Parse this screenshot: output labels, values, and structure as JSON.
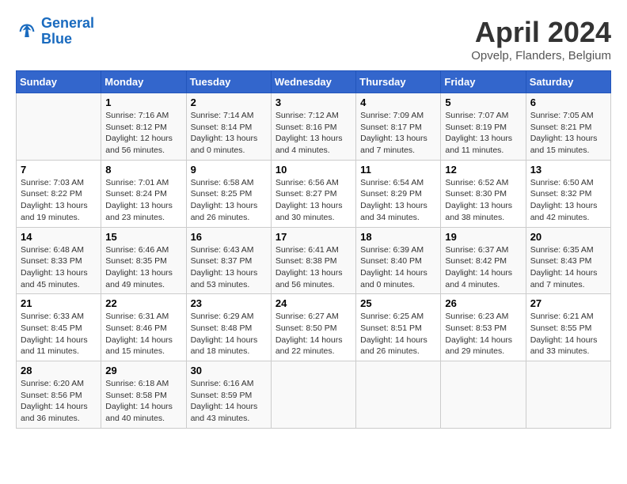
{
  "header": {
    "logo_line1": "General",
    "logo_line2": "Blue",
    "month_title": "April 2024",
    "location": "Opvelp, Flanders, Belgium"
  },
  "weekdays": [
    "Sunday",
    "Monday",
    "Tuesday",
    "Wednesday",
    "Thursday",
    "Friday",
    "Saturday"
  ],
  "weeks": [
    [
      {
        "day": "",
        "sunrise": "",
        "sunset": "",
        "daylight": ""
      },
      {
        "day": "1",
        "sunrise": "Sunrise: 7:16 AM",
        "sunset": "Sunset: 8:12 PM",
        "daylight": "Daylight: 12 hours and 56 minutes."
      },
      {
        "day": "2",
        "sunrise": "Sunrise: 7:14 AM",
        "sunset": "Sunset: 8:14 PM",
        "daylight": "Daylight: 13 hours and 0 minutes."
      },
      {
        "day": "3",
        "sunrise": "Sunrise: 7:12 AM",
        "sunset": "Sunset: 8:16 PM",
        "daylight": "Daylight: 13 hours and 4 minutes."
      },
      {
        "day": "4",
        "sunrise": "Sunrise: 7:09 AM",
        "sunset": "Sunset: 8:17 PM",
        "daylight": "Daylight: 13 hours and 7 minutes."
      },
      {
        "day": "5",
        "sunrise": "Sunrise: 7:07 AM",
        "sunset": "Sunset: 8:19 PM",
        "daylight": "Daylight: 13 hours and 11 minutes."
      },
      {
        "day": "6",
        "sunrise": "Sunrise: 7:05 AM",
        "sunset": "Sunset: 8:21 PM",
        "daylight": "Daylight: 13 hours and 15 minutes."
      }
    ],
    [
      {
        "day": "7",
        "sunrise": "Sunrise: 7:03 AM",
        "sunset": "Sunset: 8:22 PM",
        "daylight": "Daylight: 13 hours and 19 minutes."
      },
      {
        "day": "8",
        "sunrise": "Sunrise: 7:01 AM",
        "sunset": "Sunset: 8:24 PM",
        "daylight": "Daylight: 13 hours and 23 minutes."
      },
      {
        "day": "9",
        "sunrise": "Sunrise: 6:58 AM",
        "sunset": "Sunset: 8:25 PM",
        "daylight": "Daylight: 13 hours and 26 minutes."
      },
      {
        "day": "10",
        "sunrise": "Sunrise: 6:56 AM",
        "sunset": "Sunset: 8:27 PM",
        "daylight": "Daylight: 13 hours and 30 minutes."
      },
      {
        "day": "11",
        "sunrise": "Sunrise: 6:54 AM",
        "sunset": "Sunset: 8:29 PM",
        "daylight": "Daylight: 13 hours and 34 minutes."
      },
      {
        "day": "12",
        "sunrise": "Sunrise: 6:52 AM",
        "sunset": "Sunset: 8:30 PM",
        "daylight": "Daylight: 13 hours and 38 minutes."
      },
      {
        "day": "13",
        "sunrise": "Sunrise: 6:50 AM",
        "sunset": "Sunset: 8:32 PM",
        "daylight": "Daylight: 13 hours and 42 minutes."
      }
    ],
    [
      {
        "day": "14",
        "sunrise": "Sunrise: 6:48 AM",
        "sunset": "Sunset: 8:33 PM",
        "daylight": "Daylight: 13 hours and 45 minutes."
      },
      {
        "day": "15",
        "sunrise": "Sunrise: 6:46 AM",
        "sunset": "Sunset: 8:35 PM",
        "daylight": "Daylight: 13 hours and 49 minutes."
      },
      {
        "day": "16",
        "sunrise": "Sunrise: 6:43 AM",
        "sunset": "Sunset: 8:37 PM",
        "daylight": "Daylight: 13 hours and 53 minutes."
      },
      {
        "day": "17",
        "sunrise": "Sunrise: 6:41 AM",
        "sunset": "Sunset: 8:38 PM",
        "daylight": "Daylight: 13 hours and 56 minutes."
      },
      {
        "day": "18",
        "sunrise": "Sunrise: 6:39 AM",
        "sunset": "Sunset: 8:40 PM",
        "daylight": "Daylight: 14 hours and 0 minutes."
      },
      {
        "day": "19",
        "sunrise": "Sunrise: 6:37 AM",
        "sunset": "Sunset: 8:42 PM",
        "daylight": "Daylight: 14 hours and 4 minutes."
      },
      {
        "day": "20",
        "sunrise": "Sunrise: 6:35 AM",
        "sunset": "Sunset: 8:43 PM",
        "daylight": "Daylight: 14 hours and 7 minutes."
      }
    ],
    [
      {
        "day": "21",
        "sunrise": "Sunrise: 6:33 AM",
        "sunset": "Sunset: 8:45 PM",
        "daylight": "Daylight: 14 hours and 11 minutes."
      },
      {
        "day": "22",
        "sunrise": "Sunrise: 6:31 AM",
        "sunset": "Sunset: 8:46 PM",
        "daylight": "Daylight: 14 hours and 15 minutes."
      },
      {
        "day": "23",
        "sunrise": "Sunrise: 6:29 AM",
        "sunset": "Sunset: 8:48 PM",
        "daylight": "Daylight: 14 hours and 18 minutes."
      },
      {
        "day": "24",
        "sunrise": "Sunrise: 6:27 AM",
        "sunset": "Sunset: 8:50 PM",
        "daylight": "Daylight: 14 hours and 22 minutes."
      },
      {
        "day": "25",
        "sunrise": "Sunrise: 6:25 AM",
        "sunset": "Sunset: 8:51 PM",
        "daylight": "Daylight: 14 hours and 26 minutes."
      },
      {
        "day": "26",
        "sunrise": "Sunrise: 6:23 AM",
        "sunset": "Sunset: 8:53 PM",
        "daylight": "Daylight: 14 hours and 29 minutes."
      },
      {
        "day": "27",
        "sunrise": "Sunrise: 6:21 AM",
        "sunset": "Sunset: 8:55 PM",
        "daylight": "Daylight: 14 hours and 33 minutes."
      }
    ],
    [
      {
        "day": "28",
        "sunrise": "Sunrise: 6:20 AM",
        "sunset": "Sunset: 8:56 PM",
        "daylight": "Daylight: 14 hours and 36 minutes."
      },
      {
        "day": "29",
        "sunrise": "Sunrise: 6:18 AM",
        "sunset": "Sunset: 8:58 PM",
        "daylight": "Daylight: 14 hours and 40 minutes."
      },
      {
        "day": "30",
        "sunrise": "Sunrise: 6:16 AM",
        "sunset": "Sunset: 8:59 PM",
        "daylight": "Daylight: 14 hours and 43 minutes."
      },
      {
        "day": "",
        "sunrise": "",
        "sunset": "",
        "daylight": ""
      },
      {
        "day": "",
        "sunrise": "",
        "sunset": "",
        "daylight": ""
      },
      {
        "day": "",
        "sunrise": "",
        "sunset": "",
        "daylight": ""
      },
      {
        "day": "",
        "sunrise": "",
        "sunset": "",
        "daylight": ""
      }
    ]
  ]
}
